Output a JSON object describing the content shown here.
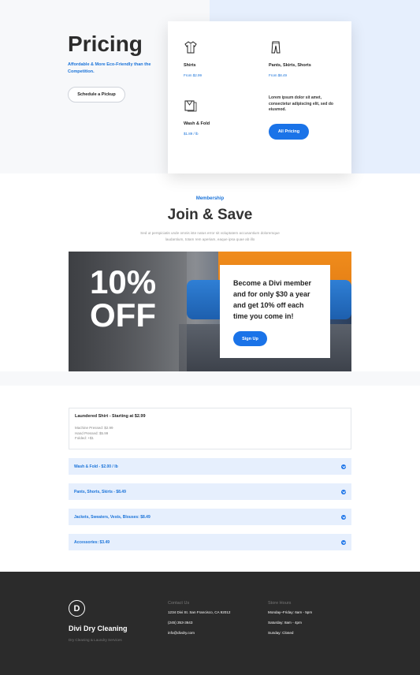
{
  "pricing": {
    "title": "Pricing",
    "subtitle": "Affordable & More Eco-Friendly than the Competition.",
    "pickup_button": "Schedule a Pickup",
    "items": [
      {
        "name": "Shirts",
        "price": "From $2.99",
        "icon": "shirt-icon"
      },
      {
        "name": "Pants, Skirts, Shorts",
        "price": "From $8.49",
        "icon": "pants-icon"
      },
      {
        "name": "Wash & Fold",
        "price": "$1.89 / lb",
        "icon": "wash-fold-icon"
      }
    ],
    "lorem": "Lorem ipsum dolor sit amet, consectetur adipiscing elit, sed do eiusmod.",
    "all_pricing_button": "All Pricing"
  },
  "membership": {
    "label": "Membership",
    "title": "Join & Save",
    "description": "Sed ut perspiciatis unde omnis iste natus error sit voluptatem accusantium doloremque laudantium, totam rem aperiam, eaque ipsa quae ab illo",
    "promo_big": "10% OFF",
    "promo_text": "Become a Divi member and for only $30 a year and get 10% off each time you come in!",
    "signup_button": "Sign Up"
  },
  "accordion": {
    "open_item": {
      "title": "Laundered Shirt - Starting at $2.99",
      "lines": [
        "Machine Pressed: $2.99",
        "Hand Pressed: $5.99",
        "Folded: +$1"
      ]
    },
    "items": [
      "Wash & Fold - $2.00 / lb",
      "Pants, Shorts, Skirts - $8.49",
      "Jackets, Sweaters, Vests, Blouses: $8.49",
      "Accessories: $3.49"
    ]
  },
  "footer": {
    "logo_letter": "D",
    "brand": "Divi Dry Cleaning",
    "tagline": "Dry Cleaning & Laundry Services",
    "contact_heading": "Contact Us",
    "contact_lines": [
      "1234 Divi St. San Francisco, CA 92012",
      "(245) 353-3643",
      "info@divdry.com"
    ],
    "hours_heading": "Store Hours",
    "hours_lines": [
      "Monday–Friday: 6am - 5pm",
      "Saturday: 8am - 4pm",
      "Sunday: Closed"
    ]
  },
  "colors": {
    "accent": "#1a73e8",
    "light_blue": "#e6effd",
    "footer_bg": "#2b2b2b"
  }
}
